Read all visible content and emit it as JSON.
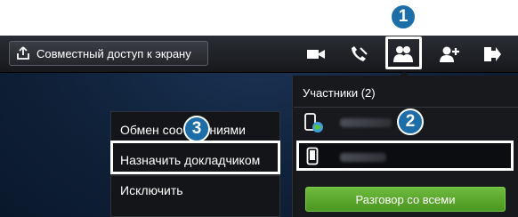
{
  "toolbar": {
    "share_label": "Совместный доступ к экрану",
    "icons": [
      "video-icon",
      "end-call-icon",
      "participants-icon",
      "add-participant-icon",
      "exit-icon"
    ]
  },
  "participants": {
    "title": "Участники (2)",
    "items": [
      {
        "name": "Samsung",
        "device": "phone-globe-icon"
      },
      {
        "name": "Samsung",
        "device": "phone-icon"
      }
    ],
    "call_all_label": "Разговор со всеми"
  },
  "menu": {
    "items": [
      "Обмен соо",
      "ниями",
      "Назначить докладчиком",
      "Исключить"
    ]
  },
  "badges": [
    "1",
    "2",
    "3"
  ],
  "colors": {
    "badge": "#1d6ea8",
    "accent_green": "#5aab2c"
  }
}
